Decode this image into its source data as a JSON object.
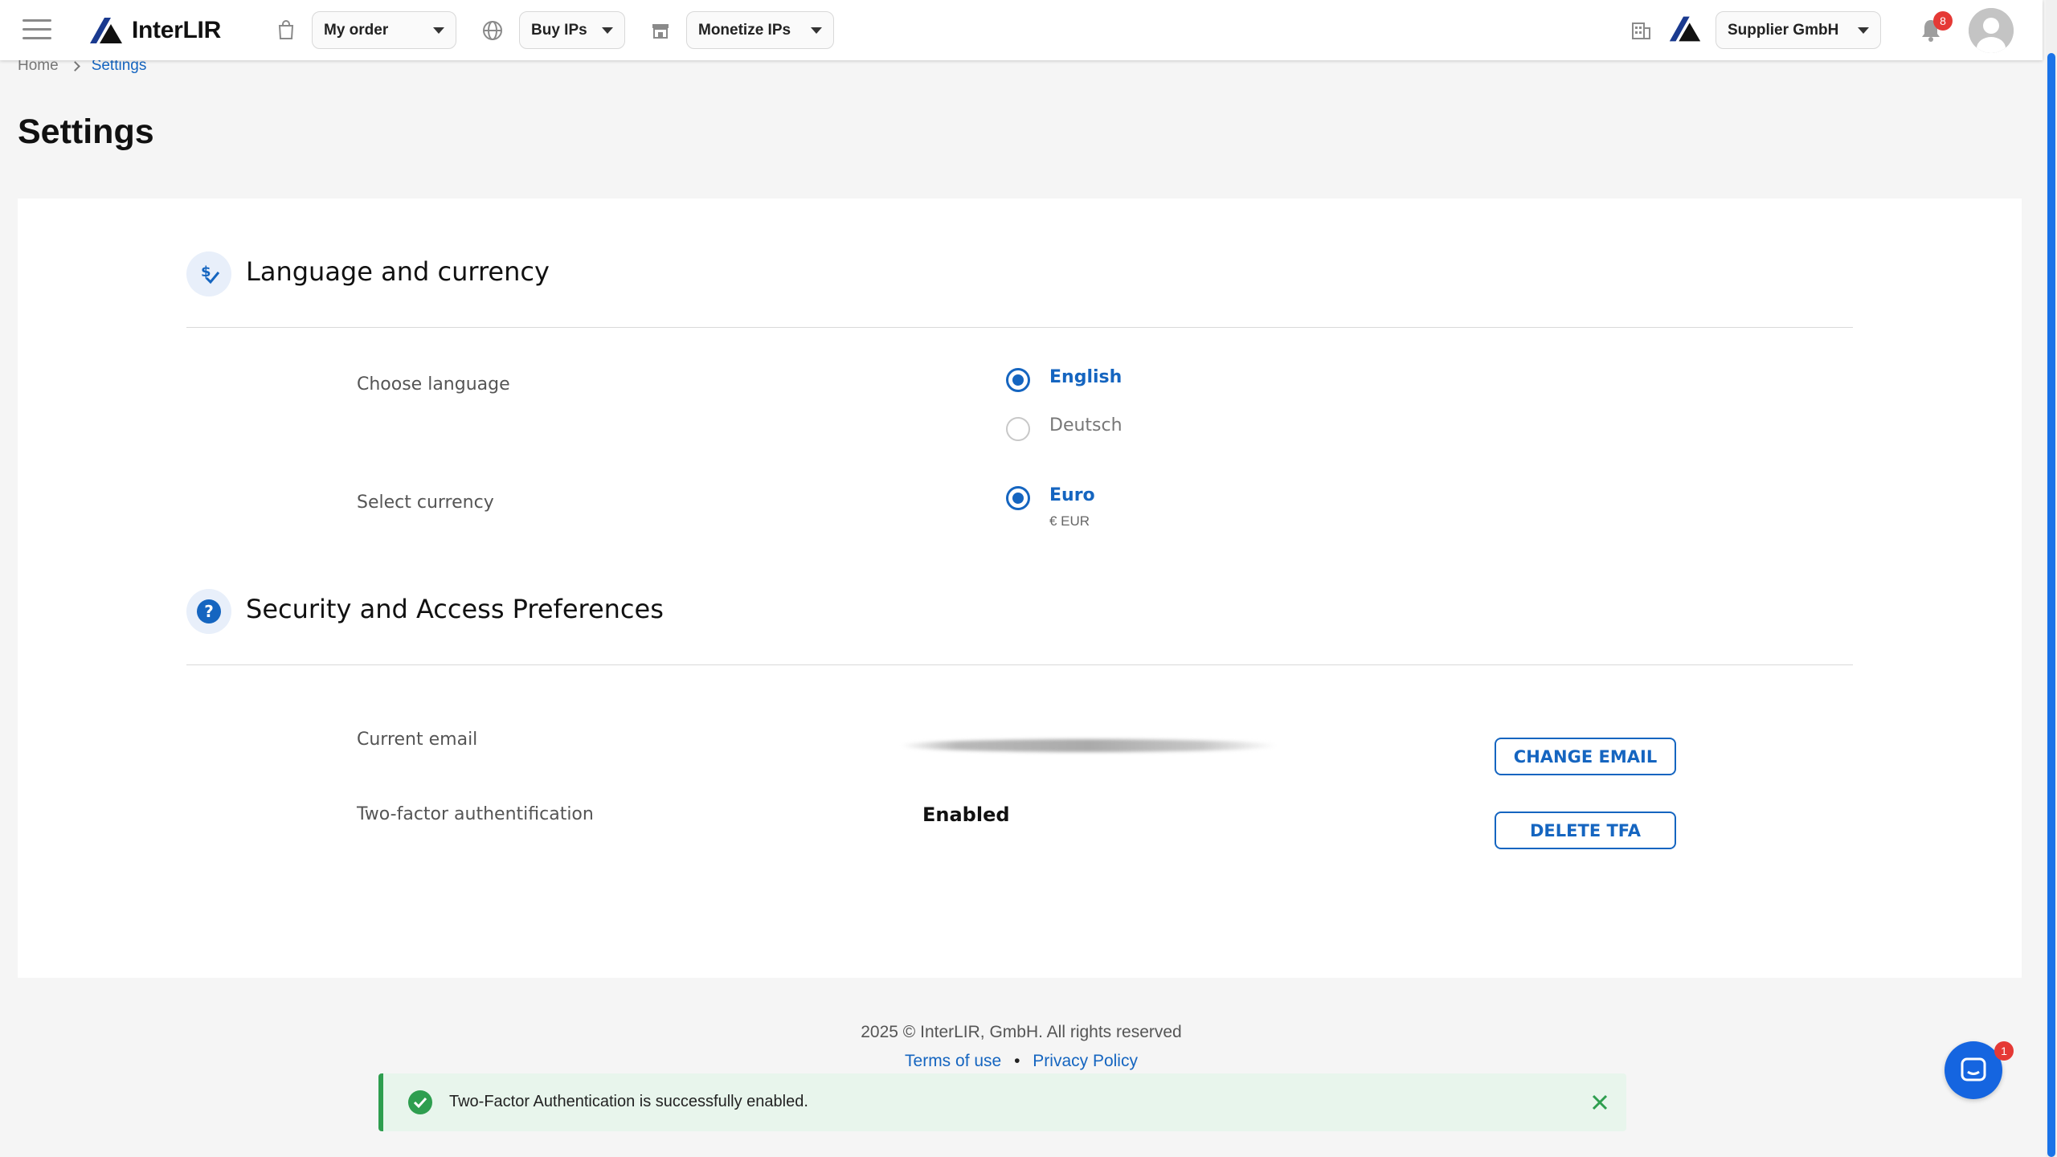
{
  "header": {
    "brand": "InterLIR",
    "menu_my_order": "My order",
    "menu_buy_ips": "Buy IPs",
    "menu_monetize_ips": "Monetize IPs",
    "company": "Supplier GmbH",
    "notification_count": "8"
  },
  "breadcrumb": {
    "home": "Home",
    "current": "Settings"
  },
  "page": {
    "title": "Settings"
  },
  "language_currency": {
    "title": "Language and currency",
    "choose_language_label": "Choose language",
    "languages": [
      {
        "label": "English",
        "selected": true
      },
      {
        "label": "Deutsch",
        "selected": false
      }
    ],
    "select_currency_label": "Select currency",
    "currency": {
      "label": "Euro",
      "sub": "€ EUR",
      "selected": true
    }
  },
  "security": {
    "title": "Security and Access Preferences",
    "current_email_label": "Current email",
    "change_email_button": "CHANGE EMAIL",
    "tfa_label": "Two-factor authentification",
    "tfa_value": "Enabled",
    "delete_tfa_button": "DELETE TFA"
  },
  "footer": {
    "copyright": "2025 © InterLIR, GmbH. All rights reserved",
    "terms": "Terms of use",
    "separator": "•",
    "privacy": "Privacy Policy"
  },
  "toast": {
    "message": "Two-Factor Authentication is successfully enabled."
  },
  "chat": {
    "badge_count": "1"
  },
  "colors": {
    "accent": "#1565c0",
    "success": "#2e9e4f",
    "badge": "#e53935"
  }
}
